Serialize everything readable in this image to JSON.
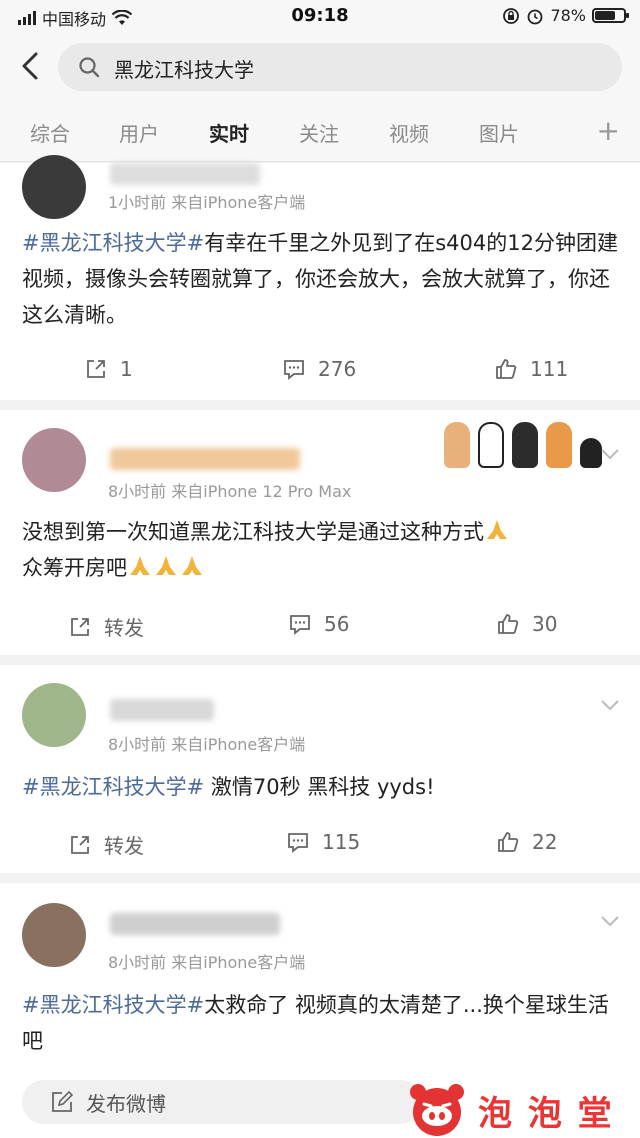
{
  "status_bar": {
    "carrier": "中国移动",
    "time": "09:18",
    "battery": "78%",
    "battery_level": 0.78
  },
  "search": {
    "query": "黑龙江科技大学"
  },
  "tabs": [
    {
      "label": "综合"
    },
    {
      "label": "用户"
    },
    {
      "label": "实时",
      "active": true
    },
    {
      "label": "关注"
    },
    {
      "label": "视频"
    },
    {
      "label": "图片"
    }
  ],
  "tab_more": "+",
  "posts": [
    {
      "meta": "1小时前  来自iPhone客户端",
      "tag": "#黑龙江科技大学#",
      "body": "有幸在千里之外见到了在s404的12分钟团建视频，摄像头会转圈就算了，你还会放大，会放大就算了，你还这么清晰。",
      "repost": "1",
      "comments": "276",
      "likes": "111"
    },
    {
      "meta": "8小时前  来自iPhone 12 Pro Max",
      "tag": "",
      "body": "没想到第一次知道黑龙江科技大学是通过这种方式",
      "body2": "众筹开房吧",
      "repost": "转发",
      "comments": "56",
      "likes": "30"
    },
    {
      "meta": "8小时前  来自iPhone客户端",
      "tag": "#黑龙江科技大学#",
      "body": " 激情70秒 黑科技 yyds!",
      "repost": "转发",
      "comments": "115",
      "likes": "22"
    },
    {
      "meta": "8小时前  来自iPhone客户端",
      "tag": "#黑龙江科技大学#",
      "body": "太救命了 视频真的太清楚了...换个星球生活吧"
    }
  ],
  "compose": {
    "label": "发布微博"
  },
  "watermark": {
    "text": "泡 泡 堂"
  },
  "colors": {
    "tag": "#4c6a9c",
    "watermark": "#e33333"
  }
}
